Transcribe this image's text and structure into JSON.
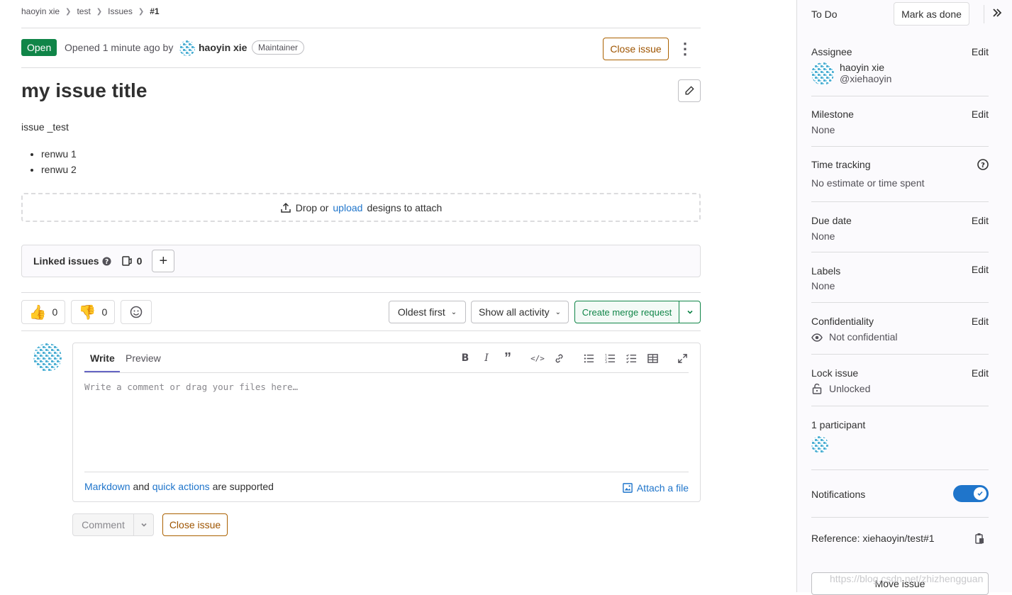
{
  "breadcrumb": {
    "items": [
      "haoyin xie",
      "test",
      "Issues"
    ],
    "current": "#1"
  },
  "issue": {
    "status": "Open",
    "opened_text": "Opened 1 minute ago by",
    "author": "haoyin xie",
    "author_role": "Maintainer",
    "close_label": "Close issue",
    "title": "my issue title",
    "description": "issue _test",
    "tasks": [
      "renwu 1",
      "renwu 2"
    ]
  },
  "design": {
    "drop": "Drop or",
    "upload": "upload",
    "suffix": "designs to attach"
  },
  "linked": {
    "label": "Linked issues",
    "count": "0"
  },
  "awards": {
    "thumbsup_count": "0",
    "thumbsdown_count": "0"
  },
  "activity": {
    "sort_label": "Oldest first",
    "filter_label": "Show all activity",
    "merge_request_label": "Create merge request"
  },
  "comment_form": {
    "tab_write": "Write",
    "tab_preview": "Preview",
    "placeholder": "Write a comment or drag your files here…",
    "markdown_link": "Markdown",
    "and_text": "and",
    "quick_actions_link": "quick actions",
    "supported_text": "are supported",
    "attach_label": "Attach a file",
    "comment_label": "Comment",
    "close_label": "Close issue"
  },
  "sidebar": {
    "todo_label": "To Do",
    "mark_done_label": "Mark as done",
    "edit_label": "Edit",
    "assignee": {
      "title": "Assignee",
      "name": "haoyin xie",
      "username": "@xiehaoyin"
    },
    "milestone": {
      "title": "Milestone",
      "value": "None"
    },
    "time_tracking": {
      "title": "Time tracking",
      "value": "No estimate or time spent"
    },
    "due_date": {
      "title": "Due date",
      "value": "None"
    },
    "labels": {
      "title": "Labels",
      "value": "None"
    },
    "confidentiality": {
      "title": "Confidentiality",
      "value": "Not confidential"
    },
    "lock": {
      "title": "Lock issue",
      "value": "Unlocked"
    },
    "participants": {
      "title": "1 participant"
    },
    "notifications": {
      "title": "Notifications",
      "enabled": true
    },
    "reference": {
      "text": "Reference: xiehaoyin/test#1"
    },
    "move_label": "Move issue"
  },
  "watermark": "https://blog.csdn.net/zhizhengguan",
  "colors": {
    "open_green": "#108548",
    "close_orange": "#ab6100",
    "link_blue": "#1f75cb",
    "toggle_blue": "#1f75cb"
  }
}
